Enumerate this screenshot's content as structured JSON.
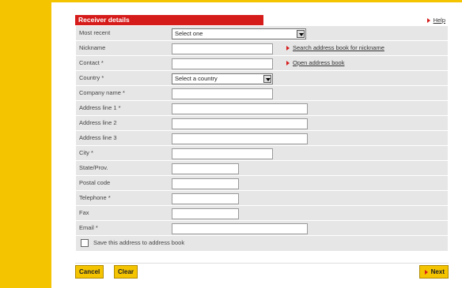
{
  "header": {
    "title": "Receiver details",
    "help": "Help"
  },
  "rows": [
    {
      "label": "Most recent",
      "type": "select",
      "value": "Select one",
      "w": 170
    },
    {
      "label": "Nickname",
      "type": "input",
      "value": "",
      "w": 128,
      "link": "Search address book for nickname"
    },
    {
      "label": "Contact *",
      "type": "input",
      "value": "",
      "w": 128,
      "link": "Open address book"
    },
    {
      "label": "Country *",
      "type": "select",
      "value": "Select a country",
      "w": 128
    },
    {
      "label": "Company name *",
      "type": "input",
      "value": "",
      "w": 128
    },
    {
      "label": "Address line 1 *",
      "type": "input",
      "value": "",
      "w": 172
    },
    {
      "label": "Address line 2",
      "type": "input",
      "value": "",
      "w": 172
    },
    {
      "label": "Address line 3",
      "type": "input",
      "value": "",
      "w": 172
    },
    {
      "label": "City *",
      "type": "input",
      "value": "",
      "w": 128
    },
    {
      "label": "State/Prov.",
      "type": "input",
      "value": "",
      "w": 85
    },
    {
      "label": "Postal code",
      "type": "input",
      "value": "",
      "w": 85
    },
    {
      "label": "Telephone *",
      "type": "input",
      "value": "",
      "w": 85
    },
    {
      "label": "Fax",
      "type": "input",
      "value": "",
      "w": 85
    },
    {
      "label": "Email *",
      "type": "input",
      "value": "",
      "w": 172
    }
  ],
  "save_address": {
    "label": "Save this address to address book",
    "checked": false
  },
  "buttons": {
    "cancel": "Cancel",
    "clear": "Clear",
    "next": "Next"
  },
  "colors": {
    "accent_yellow": "#f5c400",
    "header_red": "#d61b1b",
    "form_bg": "#e6e6e6"
  }
}
